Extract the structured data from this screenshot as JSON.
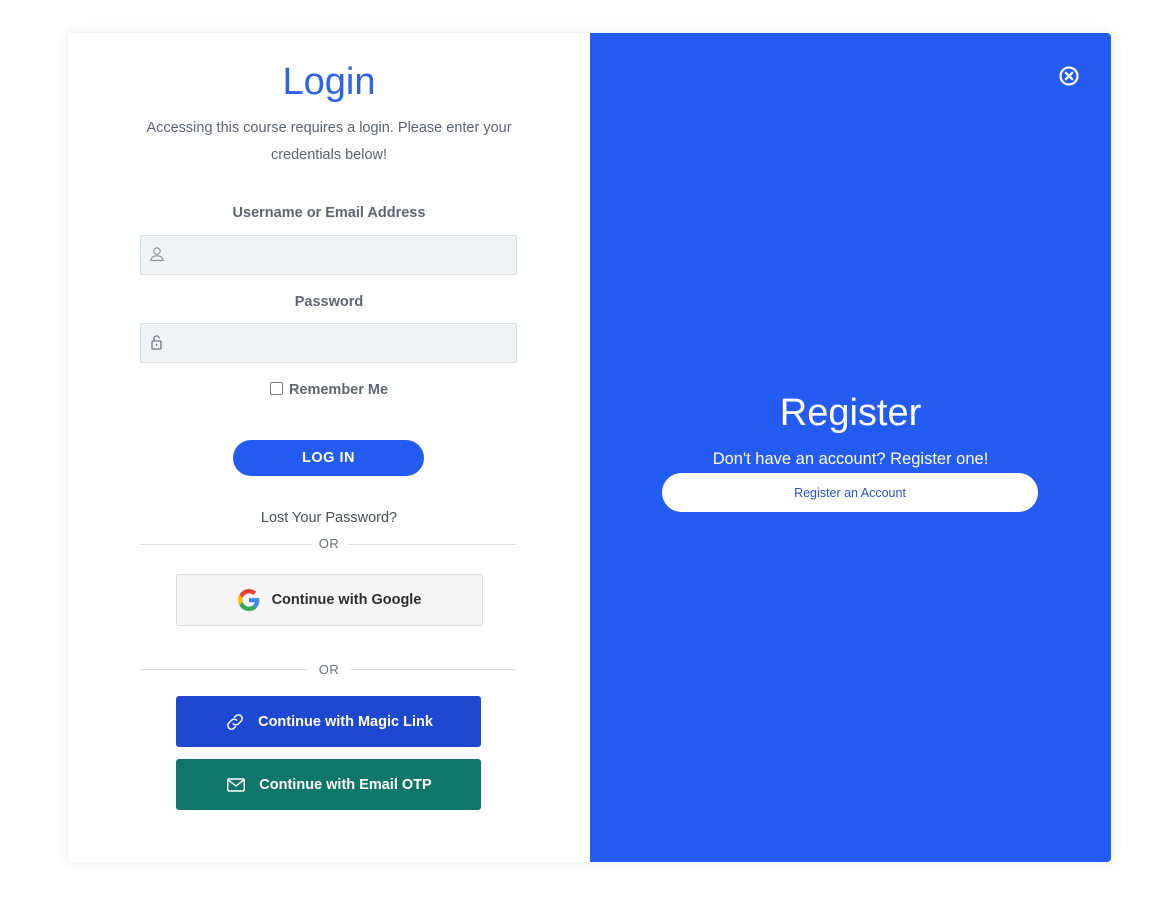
{
  "login": {
    "title": "Login",
    "description": "Accessing this course requires a login. Please enter your credentials below!",
    "username_label": "Username or Email Address",
    "username_value": "",
    "password_label": "Password",
    "password_value": "",
    "remember_label": "Remember Me",
    "remember_checked": false,
    "login_button": "LOG IN",
    "lost_password": "Lost Your Password?",
    "or_text": "OR",
    "google_button": "Continue with Google",
    "magic_link_button": "Continue with Magic Link",
    "email_otp_button": "Continue with Email OTP"
  },
  "register": {
    "title": "Register",
    "description": "Don't have an account? Register one!",
    "button": "Register an Account"
  },
  "icons": {
    "close": "close-circle-icon",
    "user": "user-icon",
    "lock": "lock-icon",
    "google": "google-icon",
    "link": "link-icon",
    "mail": "mail-icon"
  },
  "colors": {
    "accent_blue": "#245bf2",
    "title_blue": "#2c62e8",
    "magic_link": "#1f48d1",
    "email_otp": "#11766a",
    "register_button_text": "#2a52c9"
  }
}
